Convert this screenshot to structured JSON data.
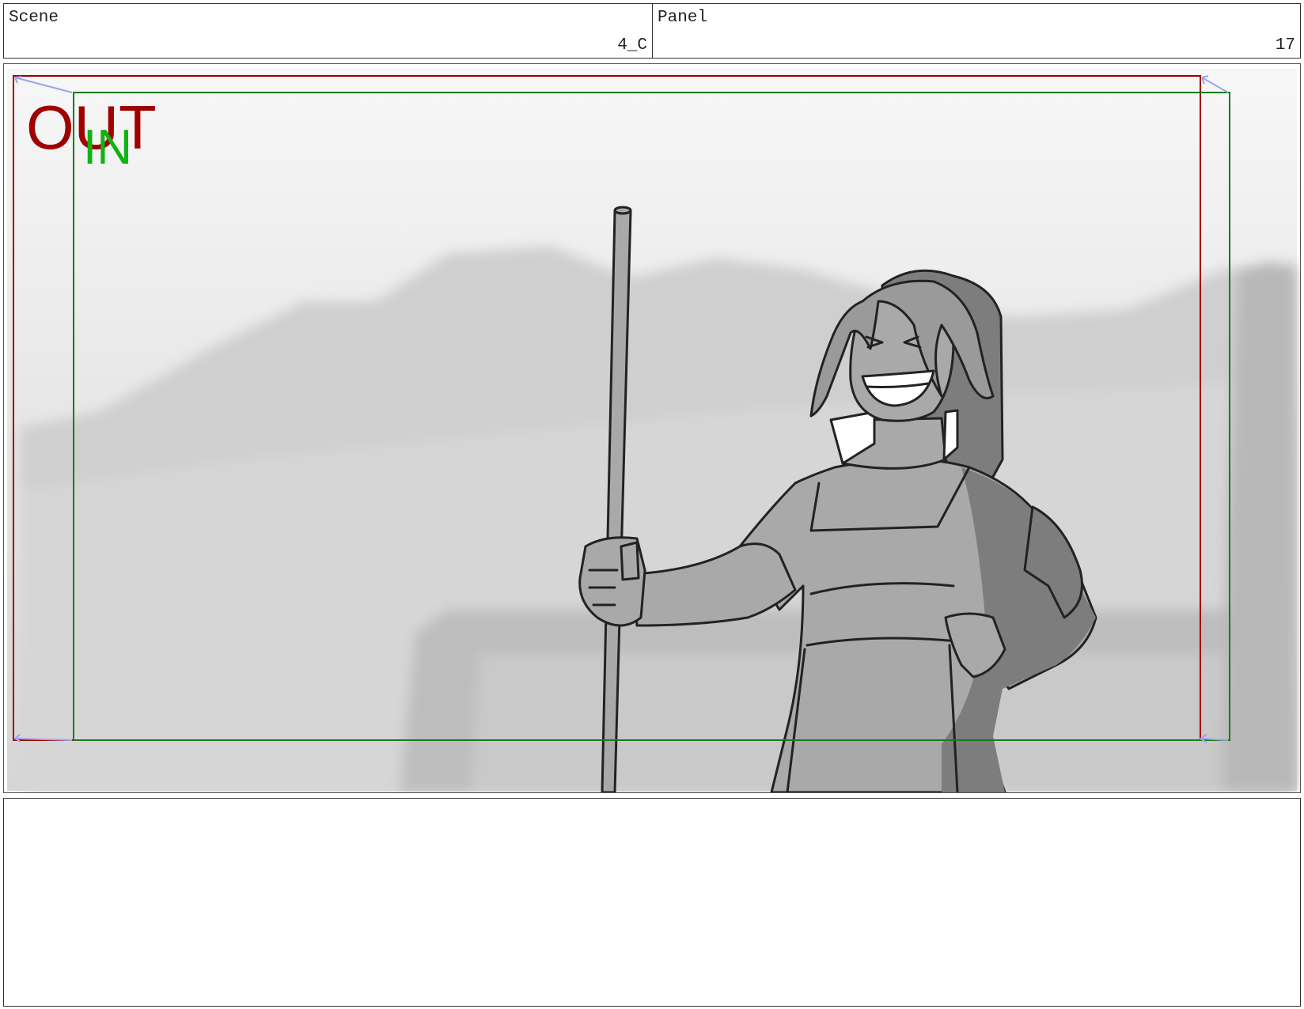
{
  "header": {
    "scene_label": "Scene",
    "scene_value": "4_C",
    "panel_label": "Panel",
    "panel_value": "17"
  },
  "frame": {
    "out_label": "OUT",
    "in_label": "IN",
    "colors": {
      "out": "#a00000",
      "in": "#1a7a1a",
      "in_text": "#11b211",
      "corner_arrows": "#9da3e8"
    }
  },
  "notes": {
    "text": ""
  }
}
